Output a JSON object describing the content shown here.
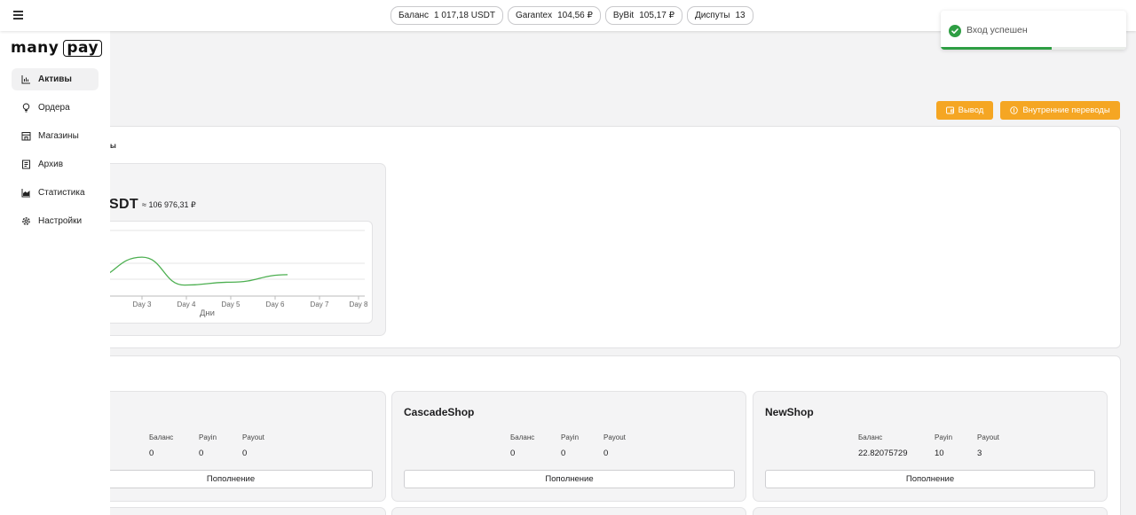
{
  "app": {
    "logo_text": "many",
    "logo_box_text": "pay",
    "menu_icon": "hamburger-icon"
  },
  "header": {
    "chips": [
      {
        "label": "Баланс",
        "value": "1 017,18 USDT"
      },
      {
        "label": "Garantex",
        "value": "104,56 ₽"
      },
      {
        "label": "ByBit",
        "value": "105,17 ₽"
      },
      {
        "label": "Диспуты",
        "value": "13"
      }
    ]
  },
  "sidebar": {
    "items": [
      {
        "label": "Активы",
        "icon": "bar-chart-icon",
        "active": true
      },
      {
        "label": "Ордера",
        "icon": "lightbulb-icon",
        "active": false
      },
      {
        "label": "Магазины",
        "icon": "store-icon",
        "active": false
      },
      {
        "label": "Архив",
        "icon": "archive-icon",
        "active": false
      },
      {
        "label": "Статистика",
        "icon": "area-chart-icon",
        "active": false
      },
      {
        "label": "Настройки",
        "icon": "gear-icon",
        "active": false
      }
    ]
  },
  "actions": {
    "withdraw_label": "Вывод",
    "transfers_label": "Внутренние переводы"
  },
  "balance_card": {
    "cut_label": "ы",
    "amount_partial": "SDT",
    "approx_rub": "≈ 106 976,31 ₽"
  },
  "chart_data": {
    "type": "line",
    "x": [
      "Day 3",
      "Day 4",
      "Day 5",
      "Day 6",
      "Day 7",
      "Day 8"
    ],
    "xlabel": "Дни",
    "series": [
      {
        "values": [
          0.72,
          0.05,
          0.12,
          0.3
        ]
      }
    ],
    "color": "#4caf50"
  },
  "shops": {
    "col_headers": [
      "Баланс",
      "Payin",
      "Payout"
    ],
    "topup_label": "Пополнение",
    "items": [
      {
        "name": "",
        "values": [
          "0",
          "0",
          "0"
        ]
      },
      {
        "name": "CascadeShop",
        "values": [
          "0",
          "0",
          "0"
        ]
      },
      {
        "name": "NewShop",
        "values": [
          "22.82075729",
          "10",
          "3"
        ]
      }
    ]
  },
  "toast": {
    "message": "Вход успешен",
    "icon": "check-circle-icon",
    "progress": 0.6
  },
  "colors": {
    "accent": "#f5a623",
    "success": "#2e9e43",
    "line": "#4caf50"
  }
}
